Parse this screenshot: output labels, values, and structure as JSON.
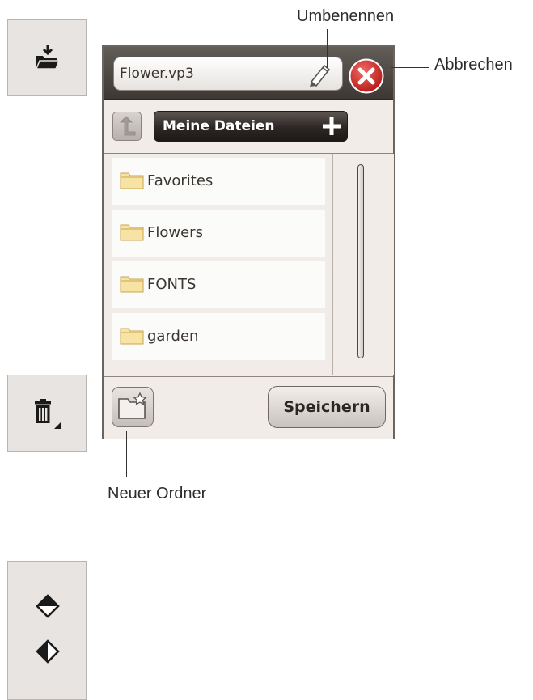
{
  "dialog": {
    "filename": "Flower.vp3",
    "current_folder": "Meine Dateien",
    "files": [
      {
        "name": "Favorites",
        "icon": "folder-icon"
      },
      {
        "name": "Flowers",
        "icon": "folder-icon"
      },
      {
        "name": "FONTS",
        "icon": "folder-icon"
      },
      {
        "name": "garden",
        "icon": "folder-icon"
      }
    ],
    "save_label": "Speichern"
  },
  "callouts": {
    "rename": "Umbenennen",
    "cancel": "Abbrechen",
    "new_folder": "Neuer Ordner"
  },
  "side_buttons": [
    {
      "icon": "load-folder-icon"
    },
    {
      "icon": "delete-trash-icon"
    },
    {
      "icon": "fill-top-diamond-icon"
    },
    {
      "icon": "fill-half-diamond-icon"
    }
  ],
  "colors": {
    "cancel_red": "#d9322e",
    "folder_yellow": "#f2d486",
    "header_dark": "#3e3834",
    "panel_bg": "#f1ece8"
  }
}
